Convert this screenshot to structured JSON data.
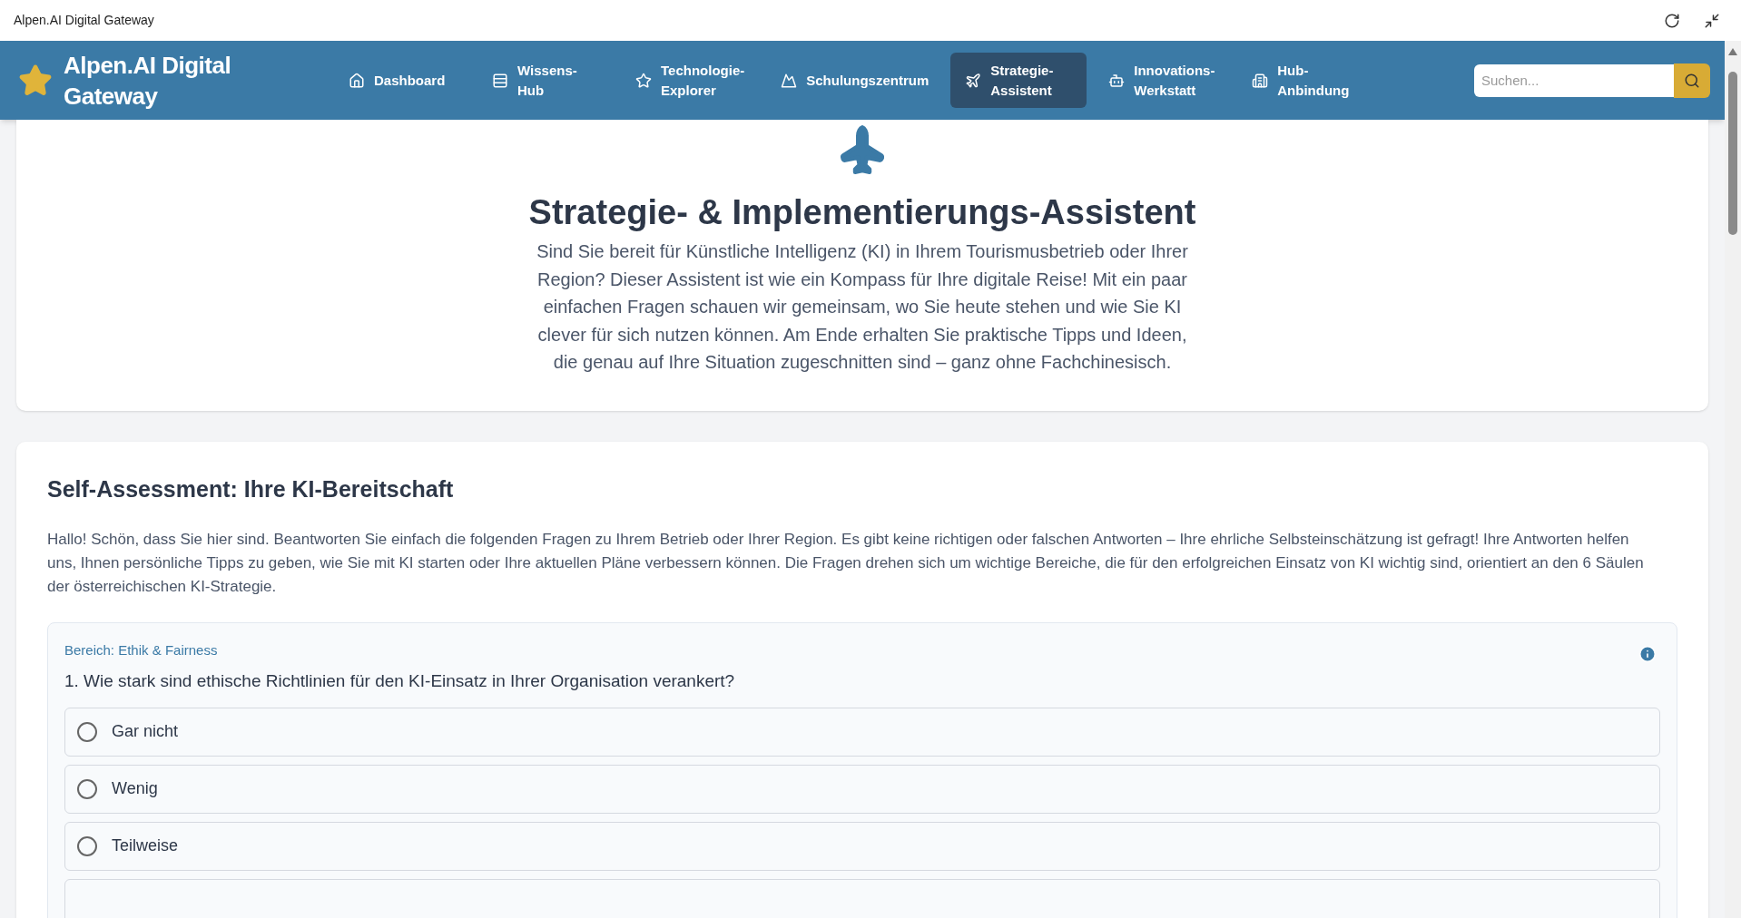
{
  "window": {
    "title": "Alpen.AI Digital Gateway"
  },
  "brand": {
    "title": "Alpen.AI Digital Gateway"
  },
  "nav": [
    {
      "label": "Dashboard",
      "kind": "home",
      "selected": false
    },
    {
      "label": "Wissens-\nHub",
      "kind": "list",
      "selected": false
    },
    {
      "label": "Technologie-\nExplorer",
      "kind": "star",
      "selected": false
    },
    {
      "label": "Schulungszentrum",
      "kind": "mountain",
      "selected": false
    },
    {
      "label": "Strategie-\nAssistent",
      "kind": "plane",
      "selected": true
    },
    {
      "label": "Innovations-\nWerkstatt",
      "kind": "bot",
      "selected": false
    },
    {
      "label": "Hub-\nAnbindung",
      "kind": "building",
      "selected": false
    }
  ],
  "search": {
    "placeholder": "Suchen..."
  },
  "hero": {
    "title": "Strategie- & Implementierungs-Assistent",
    "text": "Sind Sie bereit für Künstliche Intelligenz (KI) in Ihrem Tourismusbetrieb oder Ihrer Region? Dieser Assistent ist wie ein Kompass für Ihre digitale Reise! Mit ein paar einfachen Fragen schauen wir gemeinsam, wo Sie heute stehen und wie Sie KI clever für sich nutzen können. Am Ende erhalten Sie praktische Tipps und Ideen, die genau auf Ihre Situation zugeschnitten sind – ganz ohne Fachchinesisch."
  },
  "assessment": {
    "title": "Self-Assessment: Ihre KI-Bereitschaft",
    "intro": "Hallo! Schön, dass Sie hier sind. Beantworten Sie einfach die folgenden Fragen zu Ihrem Betrieb oder Ihrer Region. Es gibt keine richtigen oder falschen Antworten – Ihre ehrliche Selbsteinschätzung ist gefragt! Ihre Antworten helfen uns, Ihnen persönliche Tipps zu geben, wie Sie mit KI starten oder Ihre aktuellen Pläne verbessern können. Die Fragen drehen sich um wichtige Bereiche, die für den erfolgreichen Einsatz von KI wichtig sind, orientiert an den 6 Säulen der österreichischen KI-Strategie.",
    "question": {
      "area": "Bereich: Ethik & Fairness",
      "text": "1. Wie stark sind ethische Richtlinien für den KI-Einsatz in Ihrer Organisation verankert?",
      "options": [
        {
          "label": "Gar nicht",
          "selected": false
        },
        {
          "label": "Wenig",
          "selected": false
        },
        {
          "label": "Teilweise",
          "selected": false
        }
      ]
    }
  }
}
